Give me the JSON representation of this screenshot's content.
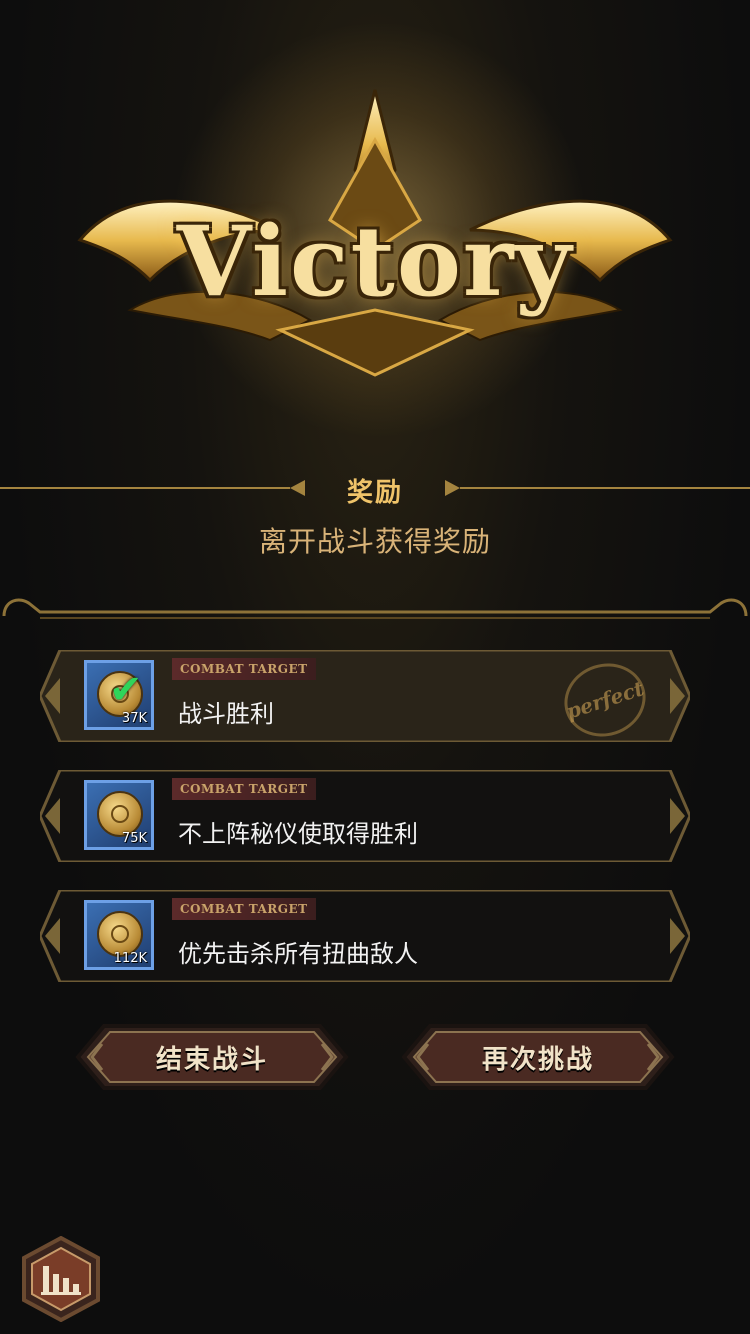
{
  "logo": {
    "text": "Victory"
  },
  "reward": {
    "title": "奖励",
    "subtitle": "离开战斗获得奖励"
  },
  "targets": [
    {
      "tag": "COMBAT TARGET",
      "text": "战斗胜利",
      "count": "37K",
      "completed": true,
      "stamp": "perfect"
    },
    {
      "tag": "COMBAT TARGET",
      "text": "不上阵秘仪使取得胜利",
      "count": "75K",
      "completed": false
    },
    {
      "tag": "COMBAT TARGET",
      "text": "优先击杀所有扭曲敌人",
      "count": "112K",
      "completed": false
    }
  ],
  "buttons": {
    "end_battle": "结束战斗",
    "retry": "再次挑战"
  },
  "icons": {
    "stats": "bar-chart-icon",
    "check": "checkmark-icon",
    "coin": "coin-icon"
  },
  "colors": {
    "gold": "#f0c46a",
    "tag_bg": "#5c2a2a",
    "icon_blue": "#3b6fb3"
  }
}
